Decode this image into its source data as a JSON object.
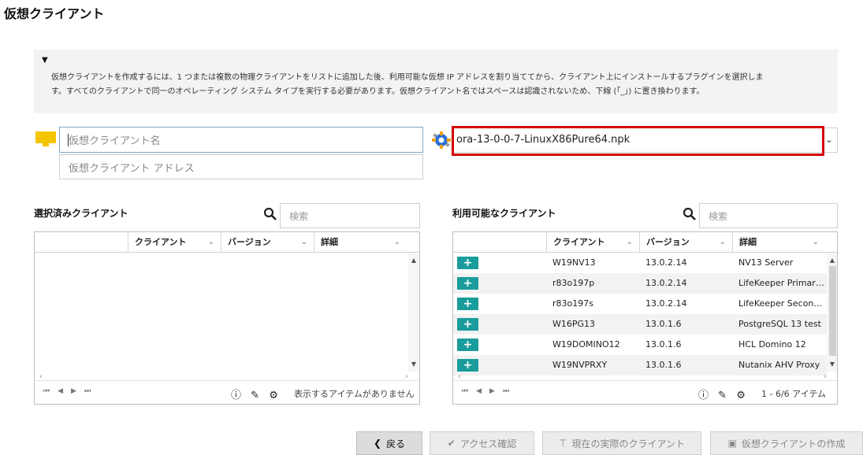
{
  "page": {
    "title": "仮想クライアント"
  },
  "info": {
    "toggle": "▼",
    "line1": "仮想クライアントを作成するには、1 つまたは複数の物理クライアントをリストに追加した後、利用可能な仮想 IP アドレスを割り当ててから、クライアント上にインストールするプラグインを選択しま",
    "line2": "す。すべてのクライアントで同一のオペレーティング システム タイプを実行する必要があります。仮想クライアント名ではスペースは認識されないため、下線 (「_」) に置き換わります。"
  },
  "form": {
    "name_placeholder": "仮想クライアント名",
    "address_placeholder": "仮想クライアント アドレス",
    "plugin_value": "ora-13-0-0-7-LinuxX86Pure64.npk"
  },
  "selected": {
    "title": "選択済みクライアント",
    "search_placeholder": "検索",
    "columns": [
      "クライアント",
      "バージョン",
      "詳細"
    ],
    "status": "表示するアイテムがありません"
  },
  "available": {
    "title": "利用可能なクライアント",
    "search_placeholder": "検索",
    "columns": [
      "クライアント",
      "バージョン",
      "詳細"
    ],
    "add_label": "+",
    "rows": [
      {
        "client": "W19NV13",
        "version": "13.0.2.14",
        "detail": "NV13 Server"
      },
      {
        "client": "r83o197p",
        "version": "13.0.2.14",
        "detail": "LifeKeeper Primar…"
      },
      {
        "client": "r83o197s",
        "version": "13.0.2.14",
        "detail": "LifeKeeper Second…"
      },
      {
        "client": "W16PG13",
        "version": "13.0.1.6",
        "detail": "PostgreSQL 13 test"
      },
      {
        "client": "W19DOMINO12",
        "version": "13.0.1.6",
        "detail": "HCL Domino 12"
      },
      {
        "client": "W19NVPRXY",
        "version": "13.0.1.6",
        "detail": "Nutanix AHV Proxy"
      }
    ],
    "status": "1 - 6/6 アイテム"
  },
  "buttons": {
    "back": "戻る",
    "check_access": "アクセス確認",
    "current_clients": "現在の実際のクライアント",
    "create": "仮想クライアントの作成"
  },
  "icons": {
    "monitor": "monitor-icon",
    "plugin": "plugin-icon",
    "search": "search-icon",
    "info": "info-icon",
    "edit": "edit-icon",
    "network": "network-icon",
    "back": "chevron-left-icon",
    "check": "check-icon",
    "filter": "filter-icon",
    "create": "save-icon"
  },
  "colors": {
    "accent": "#1a9c9c",
    "highlight": "#d40000",
    "monitor": "#f5c400"
  }
}
